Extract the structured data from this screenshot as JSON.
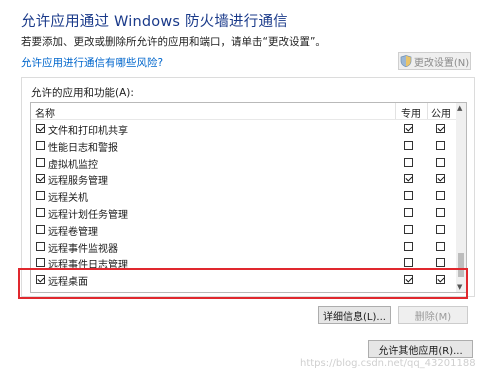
{
  "header": {
    "title": "允许应用通过 Windows 防火墙进行通信",
    "subtitle": "若要添加、更改或删除所允许的应用和端口，请单击“更改设置”。",
    "risk_link": "允许应用进行通信有哪些风险?",
    "change_settings_label": "更改设置(N)",
    "change_settings_icon": "shield-icon"
  },
  "group": {
    "label": "允许的应用和功能(A):",
    "columns": {
      "name": "名称",
      "private": "专用",
      "public": "公用"
    },
    "rows": [
      {
        "label": "文件和打印机共享",
        "enabled": true,
        "private": true,
        "public": true
      },
      {
        "label": "性能日志和警报",
        "enabled": false,
        "private": false,
        "public": false
      },
      {
        "label": "虚拟机监控",
        "enabled": false,
        "private": false,
        "public": false
      },
      {
        "label": "远程服务管理",
        "enabled": true,
        "private": true,
        "public": true
      },
      {
        "label": "远程关机",
        "enabled": false,
        "private": false,
        "public": false
      },
      {
        "label": "远程计划任务管理",
        "enabled": false,
        "private": false,
        "public": false
      },
      {
        "label": "远程卷管理",
        "enabled": false,
        "private": false,
        "public": false
      },
      {
        "label": "远程事件监视器",
        "enabled": false,
        "private": false,
        "public": false
      },
      {
        "label": "远程事件日志管理",
        "enabled": false,
        "private": false,
        "public": false
      },
      {
        "label": "远程桌面",
        "enabled": true,
        "private": true,
        "public": true
      }
    ],
    "highlight_color": "#e0282e"
  },
  "buttons": {
    "details": "详细信息(L)...",
    "delete": "删除(M)",
    "allow_other": "允许其他应用(R)..."
  },
  "watermark": "https://blog.csdn.net/qq_43201188"
}
